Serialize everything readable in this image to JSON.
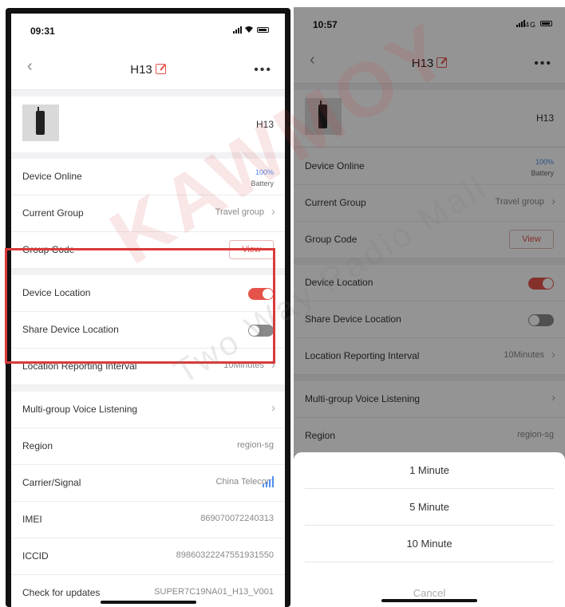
{
  "left": {
    "status_time": "09:31",
    "title": "H13",
    "device_name": "H13",
    "rows": {
      "device_online": {
        "label": "Device Online",
        "battery_pct": "100%",
        "battery_label": "Battery"
      },
      "current_group": {
        "label": "Current Group",
        "value": "Travel group"
      },
      "group_code": {
        "label": "Group Code",
        "button": "View"
      },
      "device_location": {
        "label": "Device Location",
        "toggle": true
      },
      "share_location": {
        "label": "Share Device Location",
        "toggle": false
      },
      "report_interval": {
        "label": "Location Reporting Interval",
        "value": "10Minutes"
      },
      "multi_group": {
        "label": "Multi-group Voice Listening"
      },
      "region": {
        "label": "Region",
        "value": "region-sg"
      },
      "carrier": {
        "label": "Carrier/Signal",
        "value": "China Telecom"
      },
      "imei": {
        "label": "IMEI",
        "value": "869070072240313"
      },
      "iccid": {
        "label": "ICCID",
        "value": "89860322247551931550"
      },
      "updates": {
        "label": "Check for updates",
        "value": "SUPER7C19NA01_H13_V001"
      }
    }
  },
  "right": {
    "status_time": "10:57",
    "network": "4G",
    "title": "H13",
    "device_name": "H13",
    "rows": {
      "device_online": {
        "label": "Device Online",
        "battery_pct": "100%",
        "battery_label": "Battery"
      },
      "current_group": {
        "label": "Current Group",
        "value": "Travel group"
      },
      "group_code": {
        "label": "Group Code",
        "button": "View"
      },
      "device_location": {
        "label": "Device Location",
        "toggle": true
      },
      "share_location": {
        "label": "Share Device Location",
        "toggle": false
      },
      "report_interval": {
        "label": "Location Reporting Interval",
        "value": "10Minutes"
      },
      "multi_group": {
        "label": "Multi-group Voice Listening"
      },
      "region": {
        "label": "Region",
        "value": "region-sg"
      }
    },
    "sheet": {
      "options": [
        "1 Minute",
        "5 Minute",
        "10 Minute"
      ],
      "cancel": "Cancel"
    }
  },
  "watermark": {
    "brand": "KAWMOY",
    "tagline": "Two Way Radio Mall"
  },
  "colors": {
    "accent": "#e5534b",
    "highlight": "#d93a3a",
    "link_blue": "#4c8ef0"
  }
}
